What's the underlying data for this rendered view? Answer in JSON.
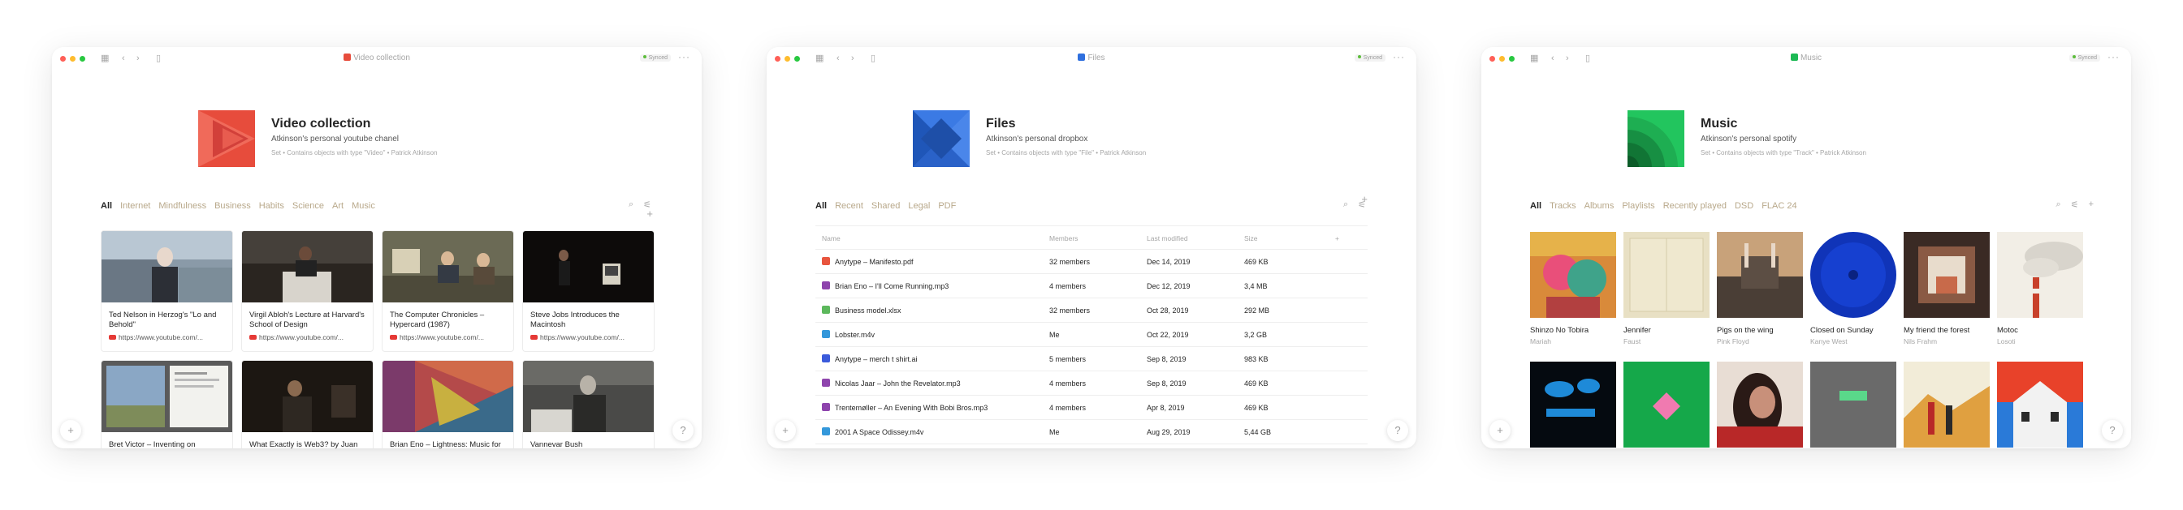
{
  "window_chrome": {
    "dot_colors": [
      "#ff5f57",
      "#febc2e",
      "#28c840"
    ],
    "synced_label": "Synced",
    "more_label": "···",
    "fab_add": "+",
    "fab_help": "?"
  },
  "video": {
    "window_title": "Video collection",
    "title": "Video collection",
    "description": "Atkinson's personal youtube chanel",
    "meta": "Set  •  Contains objects with type \"Video\"  •  Patrick Atkinson",
    "tabs": [
      "All",
      "Internet",
      "Mindfulness",
      "Business",
      "Habits",
      "Science",
      "Art",
      "Music"
    ],
    "accent": "#e74c3c",
    "cards": [
      {
        "title": "Ted Nelson in Herzog's \"Lo and Behold\"",
        "url": "https://www.youtube.com/..."
      },
      {
        "title": "Virgil Abloh's Lecture at Harvard's School of Design",
        "url": "https://www.youtube.com/..."
      },
      {
        "title": "The Computer Chronicles – Hypercard (1987)",
        "url": "https://www.youtube.com/..."
      },
      {
        "title": "Steve Jobs Introduces the Macintosh",
        "url": "https://www.youtube.com/..."
      },
      {
        "title": "Bret Victor – Inventing on",
        "url": ""
      },
      {
        "title": "What Exactly is Web3? by Juan",
        "url": ""
      },
      {
        "title": "Brian Eno – Lightness: Music for",
        "url": ""
      },
      {
        "title": "Vannevar Bush",
        "url": ""
      }
    ]
  },
  "files": {
    "window_title": "Files",
    "title": "Files",
    "description": "Atkinson's personal dropbox",
    "meta": "Set  •  Contains objects with type \"File\"  •  Patrick Atkinson",
    "tabs": [
      "All",
      "Recent",
      "Shared",
      "Legal",
      "PDF"
    ],
    "accent": "#2f6fde",
    "columns": [
      "Name",
      "Members",
      "Last modified",
      "Size"
    ],
    "add_column": "+",
    "rows": [
      {
        "name": "Anytype – Manifesto.pdf",
        "members": "32 members",
        "modified": "Dec 14, 2019",
        "size": "469 KB",
        "icon_color": "#e8553e"
      },
      {
        "name": "Brian Eno – I'll Come Running.mp3",
        "members": "4 members",
        "modified": "Dec 12, 2019",
        "size": "3,4 MB",
        "icon_color": "#8e44ad"
      },
      {
        "name": "Business model.xlsx",
        "members": "32 members",
        "modified": "Oct 28, 2019",
        "size": "292 MB",
        "icon_color": "#5cb85c"
      },
      {
        "name": "Lobster.m4v",
        "members": "Me",
        "modified": "Oct 22, 2019",
        "size": "3,2 GB",
        "icon_color": "#3498db"
      },
      {
        "name": "Anytype – merch t shirt.ai",
        "members": "5 members",
        "modified": "Sep 8, 2019",
        "size": "983 KB",
        "icon_color": "#3b5bdb"
      },
      {
        "name": "Nicolas Jaar – John the Revelator.mp3",
        "members": "4 members",
        "modified": "Sep 8, 2019",
        "size": "469 KB",
        "icon_color": "#8e44ad"
      },
      {
        "name": "Trentemøller – An Evening With Bobi Bros.mp3",
        "members": "4 members",
        "modified": "Apr 8, 2019",
        "size": "469 KB",
        "icon_color": "#8e44ad"
      },
      {
        "name": "2001 A Space Odissey.m4v",
        "members": "Me",
        "modified": "Aug 29, 2019",
        "size": "5,44 GB",
        "icon_color": "#3498db"
      }
    ]
  },
  "music": {
    "window_title": "Music",
    "title": "Music",
    "description": "Atkinson's personal spotify",
    "meta": "Set  •  Contains objects with type \"Track\"  •  Patrick Atkinson",
    "tabs": [
      "All",
      "Tracks",
      "Albums",
      "Playlists",
      "Recently played",
      "DSD",
      "FLAC 24"
    ],
    "accent": "#1db954",
    "albums": [
      {
        "title": "Shinzo No Tobira",
        "artist": "Mariah"
      },
      {
        "title": "Jennifer",
        "artist": "Faust"
      },
      {
        "title": "Pigs on the wing",
        "artist": "Pink Floyd"
      },
      {
        "title": "Closed on Sunday",
        "artist": "Kanye West"
      },
      {
        "title": "My friend the forest",
        "artist": "Nils Frahm"
      },
      {
        "title": "Motoc",
        "artist": "Losoti"
      },
      {
        "title": "",
        "artist": ""
      },
      {
        "title": "",
        "artist": ""
      },
      {
        "title": "",
        "artist": ""
      },
      {
        "title": "",
        "artist": ""
      },
      {
        "title": "",
        "artist": ""
      },
      {
        "title": "",
        "artist": ""
      }
    ]
  }
}
